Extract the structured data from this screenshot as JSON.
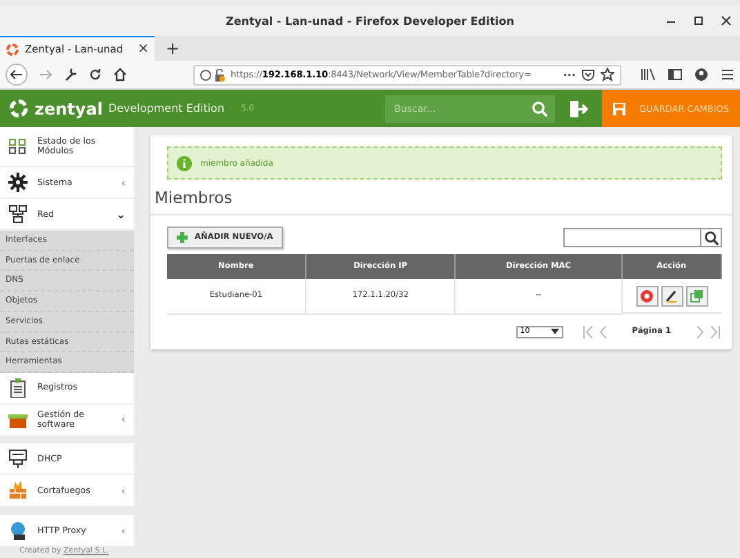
{
  "window": {
    "title": "Zentyal - Lan-unad - Firefox Developer Edition"
  },
  "browser_tab": {
    "title": "Zentyal - Lan-unad",
    "close": "×",
    "new_tab": "+"
  },
  "address_bar": {
    "url_prefix": "https://",
    "url_host": "192.168.1.10",
    "url_rest": ":8443/Network/View/MemberTable?directory=",
    "more": "···"
  },
  "header": {
    "logo": "zentyal",
    "edition": "Development Edition",
    "version": "5.0",
    "search_placeholder": "Buscar...",
    "save_button": "GUARDAR CAMBIOS"
  },
  "sidebar": {
    "items": [
      {
        "kind": "module",
        "label": "Estado de los Módulos"
      },
      {
        "kind": "module",
        "label": "Sistema",
        "arrow": "‹",
        "expanded": false
      },
      {
        "kind": "module",
        "label": "Red",
        "arrow": "⌄",
        "expanded": true,
        "children": [
          {
            "label": "Interfaces"
          },
          {
            "label": "Puertas de enlace"
          },
          {
            "label": "DNS"
          },
          {
            "label": "Objetos"
          },
          {
            "label": "Servicios"
          },
          {
            "label": "Rutas estáticas"
          },
          {
            "label": "Herramientas"
          }
        ]
      },
      {
        "kind": "module",
        "label": "Registros"
      },
      {
        "kind": "module",
        "label": "Gestión de software",
        "arrow": "‹",
        "expanded": false
      },
      {
        "kind": "gap"
      },
      {
        "kind": "module",
        "label": "DHCP"
      },
      {
        "kind": "module",
        "label": "Cortafuegos",
        "arrow": "‹",
        "expanded": false
      },
      {
        "kind": "gap"
      },
      {
        "kind": "module",
        "label": "HTTP Proxy",
        "arrow": "‹",
        "expanded": false
      }
    ],
    "footer_prefix": "Created by ",
    "footer_link": "Zentyal S.L."
  },
  "message": {
    "text": "miembro añadida"
  },
  "page_title": "Miembros",
  "add_button": "AÑADIR NUEVO/A",
  "table": {
    "columns": [
      "Nombre",
      "Dirección IP",
      "Dirección MAC",
      "Acción"
    ],
    "rows": [
      {
        "cells": [
          "Estudiane-01",
          "172.1.1.20/32",
          "--"
        ]
      }
    ]
  },
  "pager": {
    "page_size": "10",
    "page_label": "Página 1"
  }
}
